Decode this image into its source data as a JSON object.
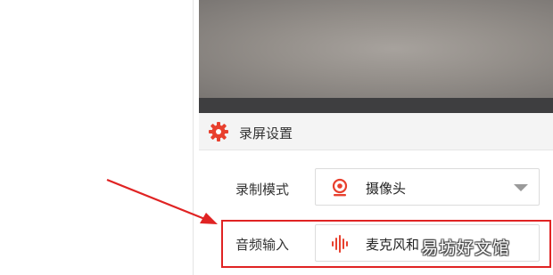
{
  "settings": {
    "header_title": "录屏设置",
    "record_mode": {
      "label": "录制模式",
      "value": "摄像头",
      "icon": "webcam-icon"
    },
    "audio_input": {
      "label": "音频输入",
      "value": "麦克风和",
      "icon": "sound-wave-icon"
    }
  },
  "watermark": "易坊好文馆",
  "colors": {
    "accent": "#e8402e",
    "annotation": "#e02323"
  }
}
